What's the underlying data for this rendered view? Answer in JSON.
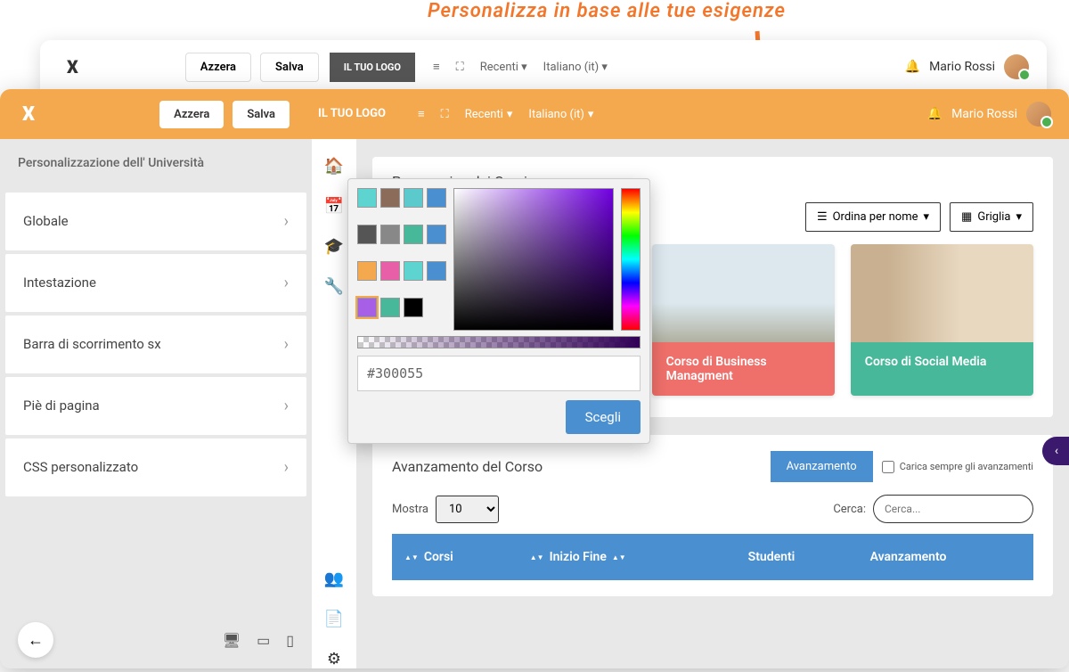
{
  "annotation": {
    "text": "Personalizza in base alle tue esigenze"
  },
  "header": {
    "reset": "Azzera",
    "save": "Salva",
    "logo": "IL TUO LOGO",
    "recent": "Recenti",
    "language": "Italiano (it)",
    "user": "Mario Rossi"
  },
  "sidebar": {
    "title": "Personalizzazione dell' Università",
    "items": [
      "Globale",
      "Intestazione",
      "Barra di scorrimento sx",
      "Piè di pagina",
      "CSS personalizzato"
    ]
  },
  "main": {
    "overview_title": "Panoramica dei Corsi",
    "sort_label": "Ordina per nome",
    "view_label": "Griglia",
    "cards": [
      {
        "title": "Corso di Business Managment",
        "color": "red"
      },
      {
        "title": "Corso di Social Media",
        "color": "green"
      }
    ],
    "progress_title": "Avanzamento del Corso",
    "progress_btn": "Avanzamento",
    "progress_check": "Carica sempre gli avanzamenti",
    "show_label": "Mostra",
    "show_value": "10",
    "search_label": "Cerca:",
    "search_placeholder": "Cerca...",
    "columns": [
      "Corsi",
      "Inizio Fine",
      "Studenti",
      "Avanzamento"
    ]
  },
  "color_picker": {
    "hex": "#300055",
    "choose": "Scegli",
    "swatches": [
      "#5dd4d0",
      "#8b6b5a",
      "#5cc9cc",
      "#4a8fcf",
      "#555555",
      "#888888",
      "#48b89a",
      "#4a8fcf",
      "#f4a94e",
      "#e85fa8",
      "#5dd4d0",
      "#4a8fcf",
      "#a85fe8",
      "#48b89a",
      "#000000"
    ],
    "selected_index": 12
  }
}
